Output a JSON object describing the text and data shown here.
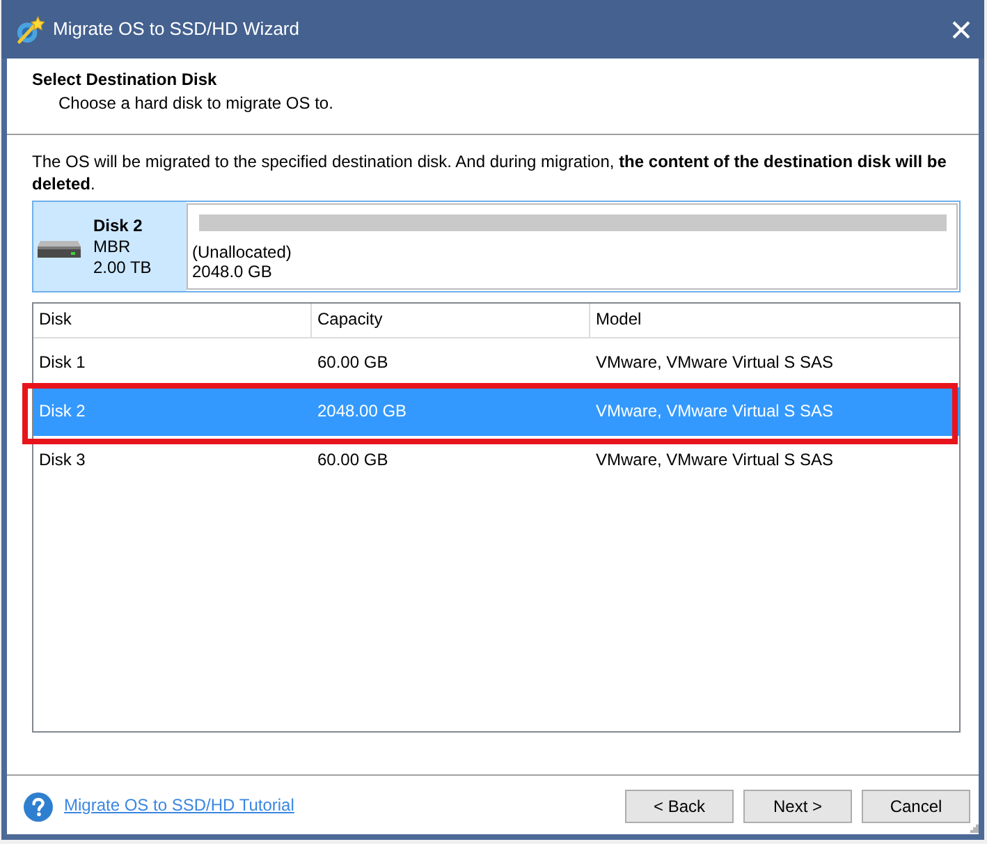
{
  "window": {
    "title": "Migrate OS to SSD/HD Wizard"
  },
  "header": {
    "title": "Select Destination Disk",
    "subtitle": "Choose a hard disk to migrate OS to."
  },
  "description": "The OS will be migrated to the specified destination disk. And during migration, **the content of the destination disk will be deleted**.",
  "disk_map": {
    "name": "Disk 2",
    "scheme": "MBR",
    "size": "2.00 TB",
    "partitions": [
      {
        "label": "(Unallocated)",
        "size": "2048.0 GB"
      }
    ]
  },
  "disk_table": {
    "columns": [
      "Disk",
      "Capacity",
      "Model"
    ],
    "rows": [
      {
        "cells": [
          "Disk 1",
          "60.00 GB",
          "VMware, VMware Virtual S SAS"
        ],
        "selected": false,
        "highlighted": false
      },
      {
        "cells": [
          "Disk 2",
          "2048.00 GB",
          "VMware, VMware Virtual S SAS"
        ],
        "selected": true,
        "highlighted": true
      },
      {
        "cells": [
          "Disk 3",
          "60.00 GB",
          "VMware, VMware Virtual S SAS"
        ],
        "selected": false,
        "highlighted": false
      }
    ]
  },
  "footer": {
    "help_link": "Migrate OS to SSD/HD Tutorial",
    "buttons": [
      "< Back",
      "Next >",
      "Cancel"
    ]
  }
}
